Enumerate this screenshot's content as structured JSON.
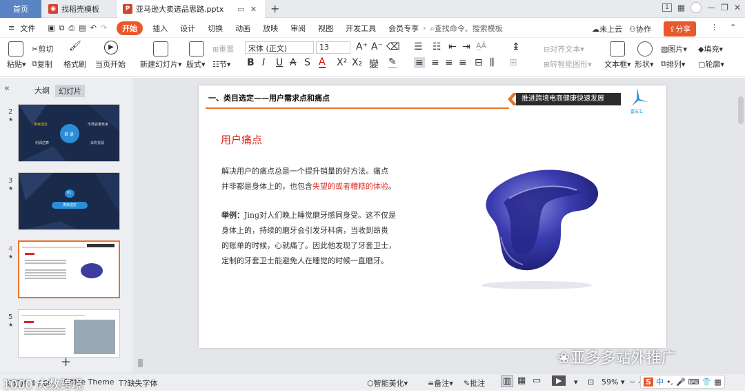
{
  "tabs": {
    "home": "首页",
    "template": "找稻壳模板",
    "doc": "亚马逊大卖选品思路.pptx"
  },
  "window": {
    "badge": "1"
  },
  "menu": {
    "file": "文件",
    "start": "开始",
    "items": [
      "插入",
      "设计",
      "切换",
      "动画",
      "放映",
      "审阅",
      "视图",
      "开发工具",
      "会员专享"
    ],
    "search": "查找命令、搜索模板",
    "cloud": "未上云",
    "collab": "协作",
    "share": "分享"
  },
  "ribbon": {
    "paste": "粘贴",
    "cut": "剪切",
    "copy": "复制",
    "format_painter": "格式刷",
    "from_current": "当页开始",
    "new_slide": "新建幻灯片",
    "layout": "版式",
    "section": "节",
    "reset": "重置",
    "font_name": "宋体 (正文)",
    "font_size": "13",
    "align_text": "对齐文本",
    "smartart": "转智能图形",
    "textbox": "文本框",
    "shape": "形状",
    "arrange": "排列",
    "picture": "图片",
    "fill": "填充",
    "outline": "轮廓"
  },
  "panel": {
    "tab_outline": "大纲",
    "tab_slides": "幻灯片",
    "slide_numbers": [
      "2",
      "3",
      "4",
      "5"
    ]
  },
  "thumbs": {
    "t2_center": "目 录",
    "t2_left_top": "类目选定",
    "t2_right_top": "市场容量竞争",
    "t2_left_bottom": "利润估算",
    "t2_right_bottom": "采购货源",
    "t3_num": "01",
    "t3_title": "类目选定"
  },
  "slide": {
    "header_title": "一、类目选定——用户需求点和痛点",
    "banner": "推进跨境电商健康快速发展",
    "logo_text": "雷友汇",
    "heading": "用户痛点",
    "para1_a": "解决用户的痛点总是一个提升销量的好方法。痛点",
    "para1_b": "并非都是身体上的，也包含",
    "para1_red": "失望的或者糟糕的体验",
    "para1_end": "。",
    "example_label": "举例：",
    "example_l1": "Jing对人们晚上睡觉磨牙感同身受。这不仅是",
    "example_l2": "身体上的，持续的磨牙会引发牙科病，当收到昂贵",
    "example_l3": "的账单的时候，心就痛了。因此他发现了牙套卫士，",
    "example_l4": "定制的牙套卫士能避免人在睡觉的时候一直磨牙。"
  },
  "statusbar": {
    "slide_info": "幻灯片 4 / 60",
    "theme": "Office Theme",
    "missing_font": "缺失字体",
    "beautify": "智能美化",
    "notes": "备注",
    "comments": "批注",
    "zoom": "59%"
  },
  "watermark": {
    "left": "1000 大数跨境",
    "right": "亚多多站外推广"
  },
  "colors": {
    "accent": "#e8582a",
    "red_text": "#e0302c",
    "heading_red": "#d9261c",
    "dark_thumb": "#1a2a4a"
  }
}
